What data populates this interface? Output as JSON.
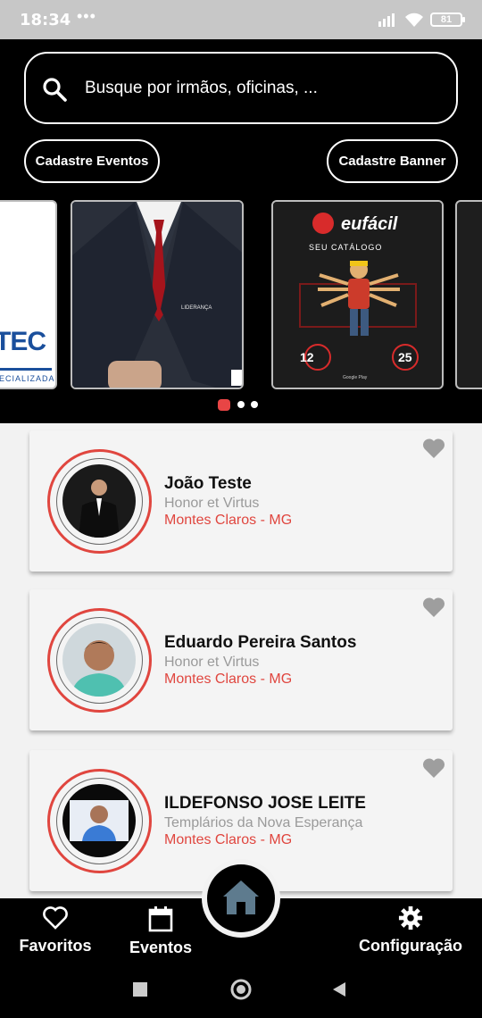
{
  "status_bar": {
    "time": "18:34",
    "dots": "•••",
    "battery": "81"
  },
  "search": {
    "placeholder": "Busque por irmãos, oficinas, ..."
  },
  "actions": {
    "left_label": "Cadastre Eventos",
    "right_label": "Cadastre Banner"
  },
  "banners": {
    "b1": {
      "text": "TEC",
      "sub": "PECIALIZADA"
    },
    "b2": {
      "text": "LIDERANÇA"
    },
    "b3": {
      "brand": "eufácil",
      "catalog": "SEU CATÁLOGO",
      "left_num": "12",
      "right_num": "25",
      "store": "Google Play"
    }
  },
  "carousel": {
    "active_index": 0,
    "count": 3
  },
  "members": [
    {
      "name": "João Teste",
      "lodge": "Honor et Virtus",
      "city": "Montes Claros - MG"
    },
    {
      "name": "Eduardo Pereira Santos",
      "lodge": "Honor et Virtus",
      "city": "Montes Claros - MG"
    },
    {
      "name": "ILDEFONSO JOSE LEITE",
      "lodge": "Templários da Nova Esperança",
      "city": "Montes Claros - MG"
    }
  ],
  "nav": {
    "favorites": "Favoritos",
    "events": "Eventos",
    "settings": "Configuração"
  },
  "colors": {
    "accent": "#e0463f",
    "header_bg": "#000000",
    "card_bg": "#f4f4f4",
    "heart": "#9e9e9e"
  },
  "icons": [
    "search-icon",
    "heart-icon",
    "calendar-icon",
    "home-icon",
    "gear-icon",
    "wifi-icon",
    "signal-icon",
    "battery-icon"
  ]
}
